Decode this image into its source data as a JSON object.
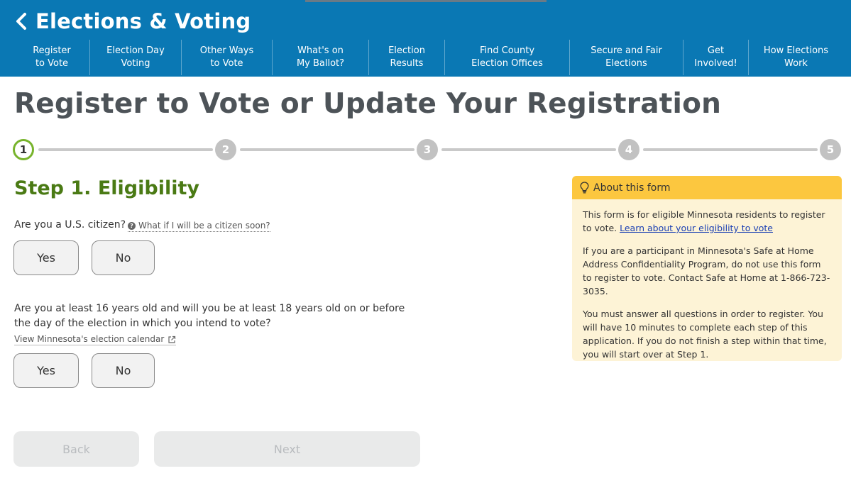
{
  "header": {
    "site_title": "Elections & Voting",
    "background_color": "#0a78b4",
    "nav_items": [
      {
        "label": "Register\nto Vote"
      },
      {
        "label": "Election Day\nVoting"
      },
      {
        "label": "Other Ways\nto Vote"
      },
      {
        "label": "What's on\nMy Ballot?"
      },
      {
        "label": "Election\nResults"
      },
      {
        "label": "Find County\nElection Offices"
      },
      {
        "label": "Secure and Fair\nElections"
      },
      {
        "label": "Get\nInvolved!"
      },
      {
        "label": "How Elections\nWork"
      }
    ]
  },
  "page_title": "Register to Vote or Update Your Registration",
  "stepper": {
    "current_step": 1,
    "steps": [
      "1",
      "2",
      "3",
      "4",
      "5"
    ],
    "active_color": "#78b42d",
    "inactive_color": "#c2c2c2"
  },
  "form": {
    "step_heading": "Step 1. Eligibility",
    "heading_color": "#4a7a14",
    "question_1": {
      "text": "Are you a U.S. citizen?",
      "help_link": "What if I will be a citizen soon?",
      "yes_label": "Yes",
      "no_label": "No"
    },
    "question_2": {
      "text": "Are you at least 16 years old and will you be at least 18 years old on or before the day of the election in which you intend to vote?",
      "calendar_link": "View Minnesota's election calendar",
      "yes_label": "Yes",
      "no_label": "No"
    },
    "back_label": "Back",
    "next_label": "Next"
  },
  "info_panel": {
    "title": "About this form",
    "header_color": "#fcc73f",
    "body_color": "#fdf3d6",
    "para1_text": "This form is for eligible Minnesota residents to register to vote. ",
    "para1_link": "Learn about your eligibility to vote",
    "para2": "If you are a participant in Minnesota's Safe at Home Address Confidentiality Program, do not use this form to register to vote. Contact Safe at Home at 1-866-723-3035.",
    "para3": "You must answer all questions in order to register. You will have 10 minutes to complete each step of this application. If you do not finish a step within that time, you will start over at Step 1."
  }
}
